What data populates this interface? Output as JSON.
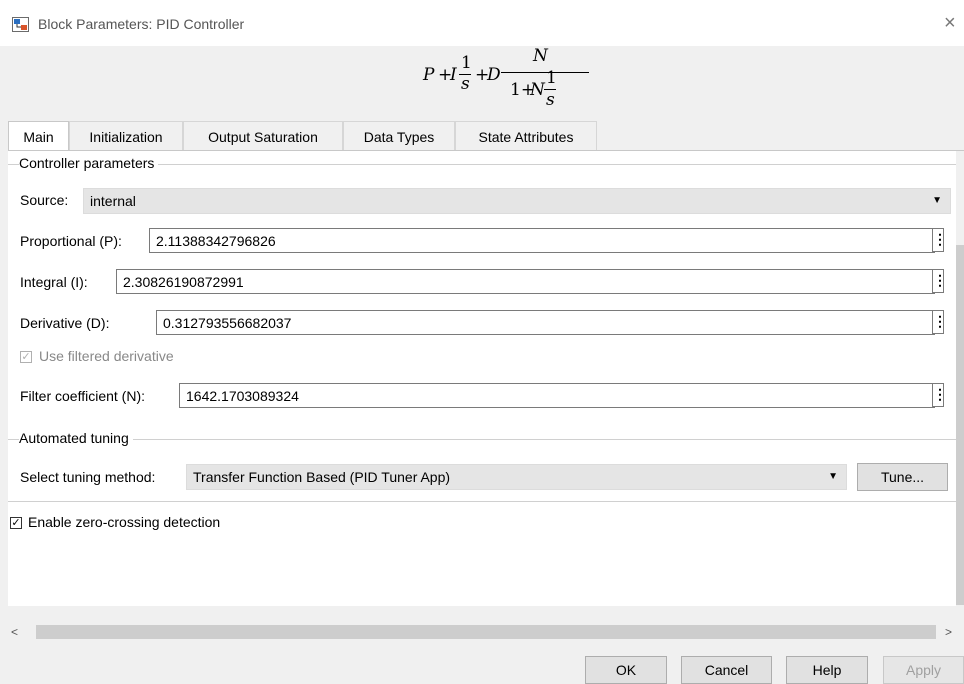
{
  "window": {
    "title": "Block Parameters: PID Controller",
    "close_glyph": "×"
  },
  "formula": {
    "p": "P",
    "plus1": "+",
    "i": "I",
    "one_a": "1",
    "s_a": "s",
    "plus2": "+",
    "d": "D",
    "n_num": "N",
    "one_plus": "1+",
    "n_den": "N",
    "one_b": "1",
    "s_b": "s"
  },
  "tabs": [
    {
      "label": "Main",
      "active": true
    },
    {
      "label": "Initialization",
      "active": false
    },
    {
      "label": "Output Saturation",
      "active": false
    },
    {
      "label": "Data Types",
      "active": false
    },
    {
      "label": "State Attributes",
      "active": false
    }
  ],
  "controller_parameters": {
    "group_title": "Controller parameters",
    "source_label": "Source:",
    "source_value": "internal",
    "proportional_label": "Proportional (P):",
    "proportional_value": "2.11388342796826",
    "integral_label": "Integral (I):",
    "integral_value": "2.30826190872991",
    "derivative_label": "Derivative (D):",
    "derivative_value": "0.312793556682037",
    "use_filtered_label": "Use filtered derivative",
    "use_filtered_checked": true,
    "filter_label": "Filter coefficient (N):",
    "filter_value": "1642.1703089324",
    "more_glyph": "⋮"
  },
  "automated_tuning": {
    "group_title": "Automated tuning",
    "method_label": "Select tuning method:",
    "method_value": "Transfer Function Based (PID Tuner App)",
    "tune_button": "Tune..."
  },
  "zero_crossing": {
    "label": "Enable zero-crossing detection",
    "checked": true
  },
  "scroll": {
    "left_arrow": "<",
    "right_arrow": ">"
  },
  "footer": {
    "ok": "OK",
    "cancel": "Cancel",
    "help": "Help",
    "apply": "Apply"
  },
  "icons": {
    "dropdown": "chevron-down-icon",
    "check": "checkmark-icon"
  }
}
